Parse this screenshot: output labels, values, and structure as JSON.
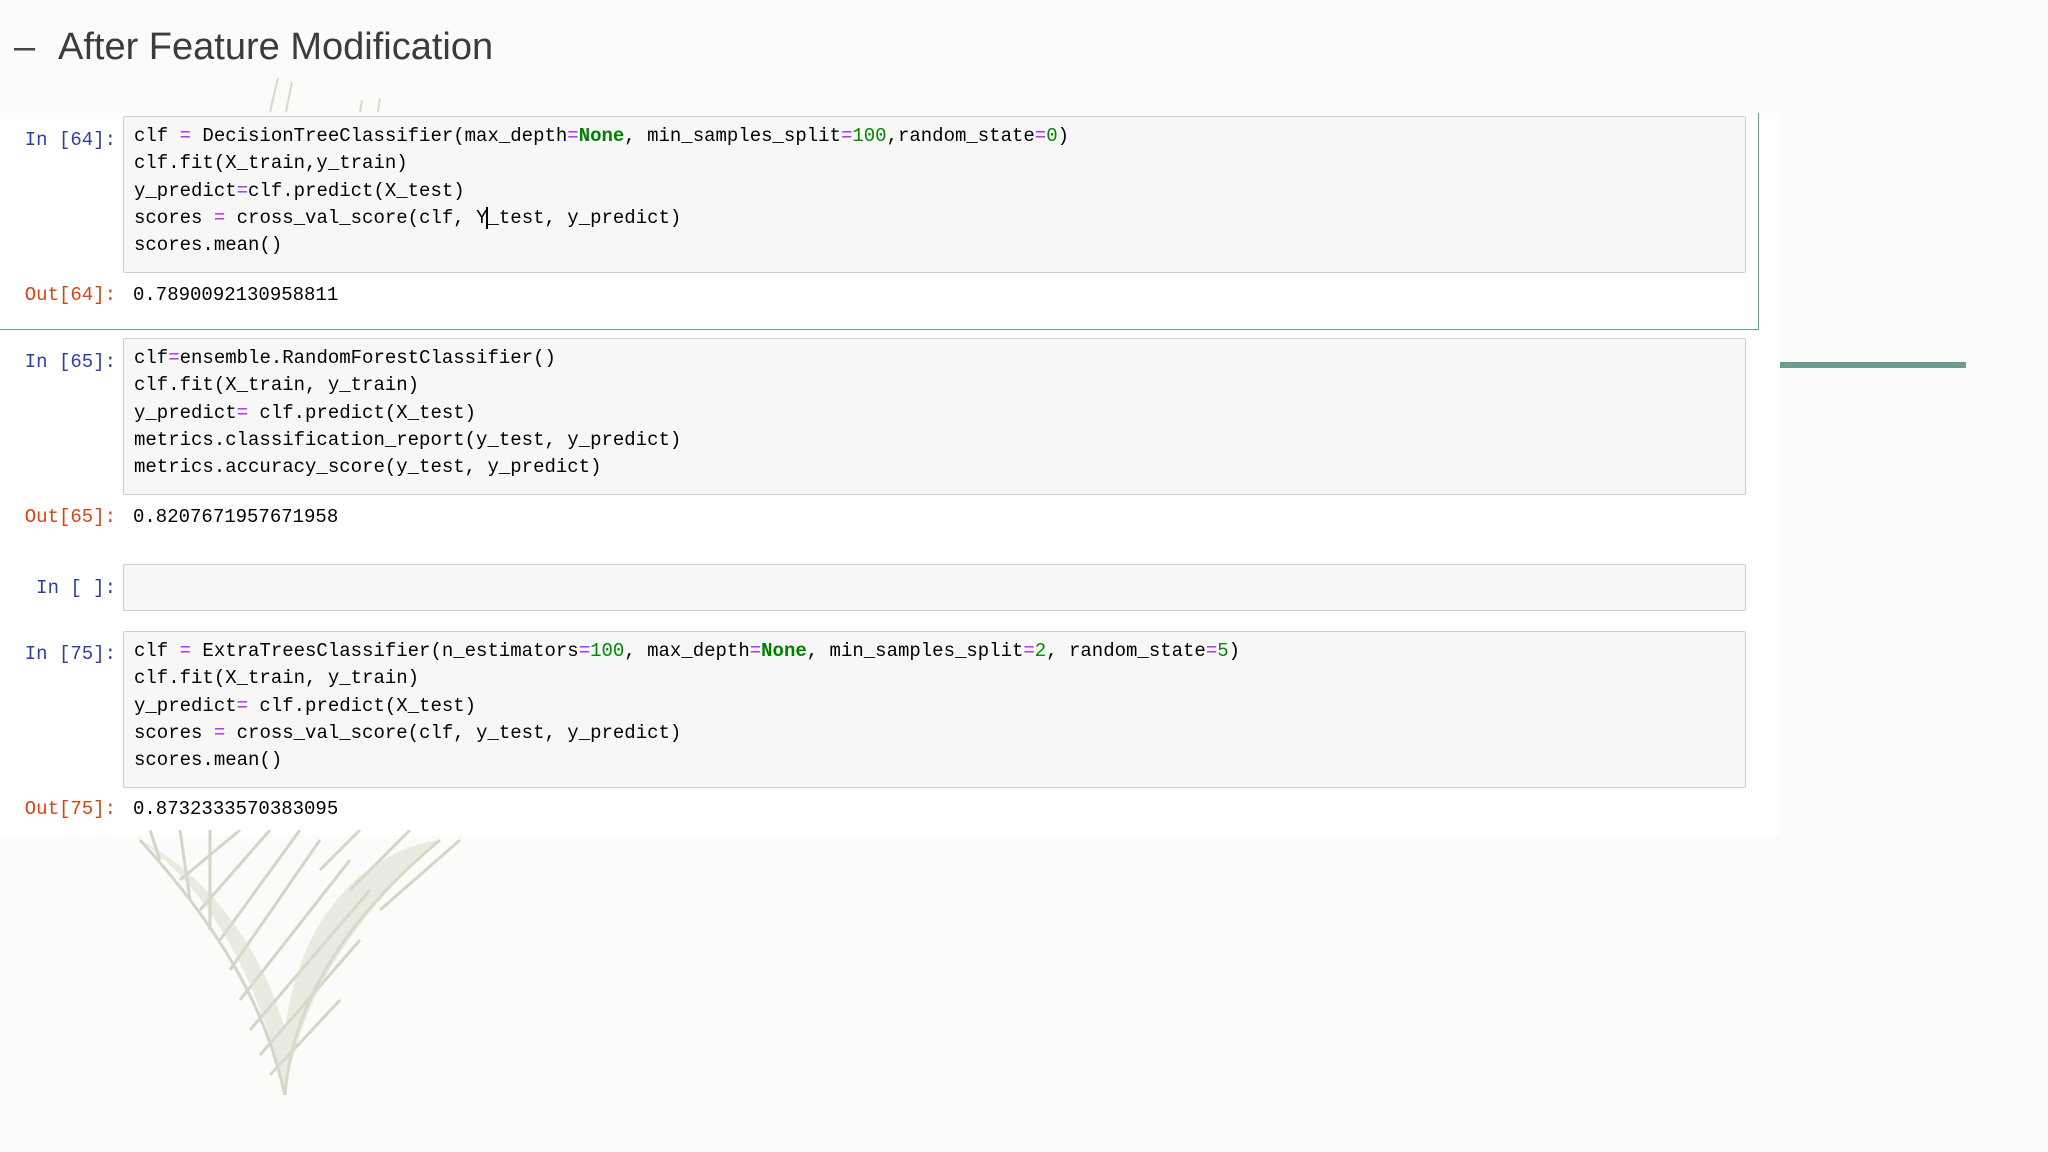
{
  "slide": {
    "title_dash": "–",
    "title": "After Feature Modification"
  },
  "cells": [
    {
      "in_prompt": "In [64]:",
      "code": [
        [
          {
            "t": "clf ",
            "c": ""
          },
          {
            "t": "=",
            "c": "op"
          },
          {
            "t": " DecisionTreeClassifier(max_depth",
            "c": ""
          },
          {
            "t": "=",
            "c": "op"
          },
          {
            "t": "None",
            "c": "kw"
          },
          {
            "t": ", min_samples_split",
            "c": ""
          },
          {
            "t": "=",
            "c": "op"
          },
          {
            "t": "100",
            "c": "num"
          },
          {
            "t": ",random_state",
            "c": ""
          },
          {
            "t": "=",
            "c": "op"
          },
          {
            "t": "0",
            "c": "num"
          },
          {
            "t": ")",
            "c": ""
          }
        ],
        [
          {
            "t": "clf.fit(X_train,y_train)",
            "c": ""
          }
        ],
        [
          {
            "t": "y_predict",
            "c": ""
          },
          {
            "t": "=",
            "c": "op"
          },
          {
            "t": "clf.predict(X_test)",
            "c": ""
          }
        ],
        [
          {
            "t": "scores ",
            "c": ""
          },
          {
            "t": "=",
            "c": "op"
          },
          {
            "t": " cross_val_score(clf, Y",
            "c": ""
          },
          {
            "t": "|",
            "c": "cursor"
          },
          {
            "t": "_test, y_predict)",
            "c": ""
          }
        ],
        [
          {
            "t": "scores.mean()",
            "c": ""
          }
        ]
      ],
      "out_prompt": "Out[64]:",
      "output": "0.7890092130958811"
    },
    {
      "in_prompt": "In [65]:",
      "code": [
        [
          {
            "t": "clf",
            "c": ""
          },
          {
            "t": "=",
            "c": "op"
          },
          {
            "t": "ensemble.RandomForestClassifier()",
            "c": ""
          }
        ],
        [
          {
            "t": "clf.fit(X_train, y_train)",
            "c": ""
          }
        ],
        [
          {
            "t": "y_predict",
            "c": ""
          },
          {
            "t": "=",
            "c": "op"
          },
          {
            "t": " clf.predict(X_test)",
            "c": ""
          }
        ],
        [
          {
            "t": "metrics.classification_report(y_test, y_predict)",
            "c": ""
          }
        ],
        [
          {
            "t": "metrics.accuracy_score(y_test, y_predict)",
            "c": ""
          }
        ]
      ],
      "out_prompt": "Out[65]:",
      "output": "0.8207671957671958"
    },
    {
      "in_prompt": "In [ ]:",
      "code": [],
      "out_prompt": "",
      "output": ""
    },
    {
      "in_prompt": "In [75]:",
      "code": [
        [
          {
            "t": "clf ",
            "c": ""
          },
          {
            "t": "=",
            "c": "op"
          },
          {
            "t": " ExtraTreesClassifier(n_estimators",
            "c": ""
          },
          {
            "t": "=",
            "c": "op"
          },
          {
            "t": "100",
            "c": "num"
          },
          {
            "t": ", max_depth",
            "c": ""
          },
          {
            "t": "=",
            "c": "op"
          },
          {
            "t": "None",
            "c": "kw"
          },
          {
            "t": ", min_samples_split",
            "c": ""
          },
          {
            "t": "=",
            "c": "op"
          },
          {
            "t": "2",
            "c": "num"
          },
          {
            "t": ", random_state",
            "c": ""
          },
          {
            "t": "=",
            "c": "op"
          },
          {
            "t": "5",
            "c": "num"
          },
          {
            "t": ")",
            "c": ""
          }
        ],
        [
          {
            "t": "clf.fit(X_train, y_train)",
            "c": ""
          }
        ],
        [
          {
            "t": "y_predict",
            "c": ""
          },
          {
            "t": "=",
            "c": "op"
          },
          {
            "t": " clf.predict(X_test)",
            "c": ""
          }
        ],
        [
          {
            "t": "scores ",
            "c": ""
          },
          {
            "t": "=",
            "c": "op"
          },
          {
            "t": " cross_val_score(clf, y_test, y_predict)",
            "c": ""
          }
        ],
        [
          {
            "t": "scores.mean()",
            "c": ""
          }
        ]
      ],
      "out_prompt": "Out[75]:",
      "output": "0.8732333570383095"
    }
  ],
  "colors": {
    "accent": "#6e9b90",
    "in_prompt": "#303f9f",
    "out_prompt": "#d84315",
    "keyword": "#008000",
    "operator": "#aa22ff"
  }
}
